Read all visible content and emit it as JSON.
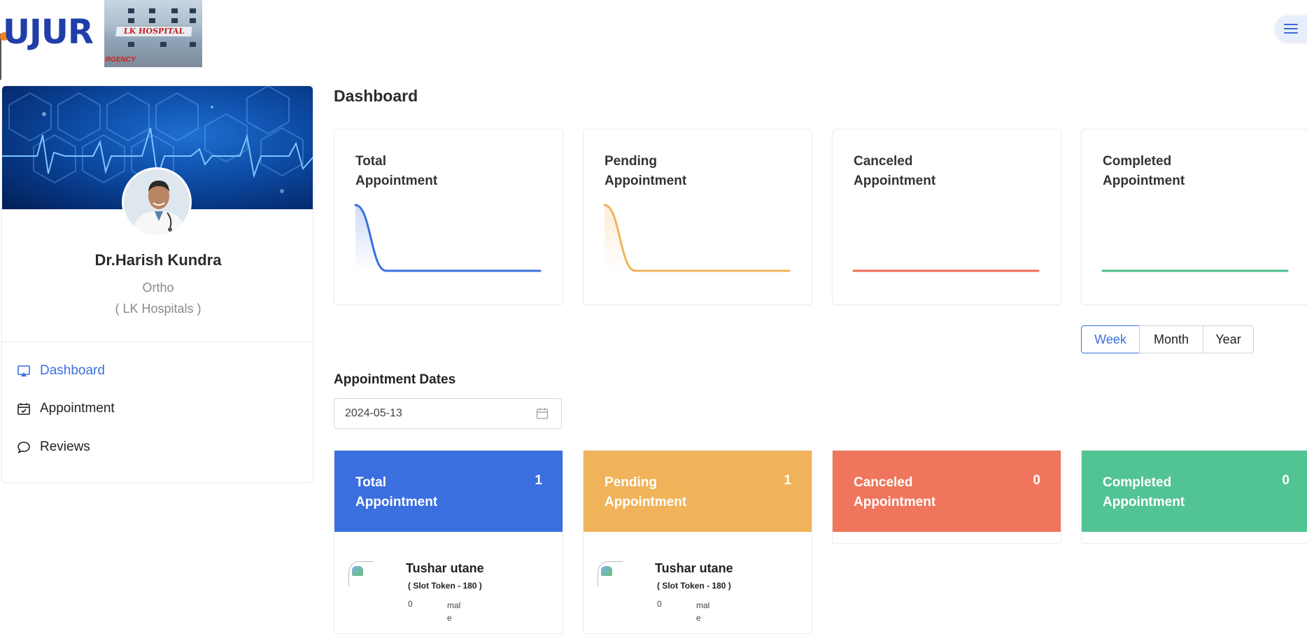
{
  "header": {
    "brand_text": "UJUR",
    "hospital_sign": "LK HOSPITAL",
    "hospital_sign_sub": "RGENCY",
    "menu_icon": "hamburger-menu-icon"
  },
  "sidebar": {
    "doctor_name": "Dr.Harish Kundra",
    "specialty": "Ortho",
    "hospital": "( LK Hospitals )",
    "items": [
      {
        "label": "Dashboard",
        "icon": "airplay-icon",
        "active": true
      },
      {
        "label": "Appointment",
        "icon": "calendar-check-icon",
        "active": false
      },
      {
        "label": "Reviews",
        "icon": "chat-bubble-icon",
        "active": false
      }
    ]
  },
  "main": {
    "title": "Dashboard",
    "stat_cards": [
      {
        "line1": "Total",
        "line2": "Appointment",
        "color": "#3b6fe0"
      },
      {
        "line1": "Pending",
        "line2": "Appointment",
        "color": "#f0b35a"
      },
      {
        "line1": "Canceled",
        "line2": "Appointment",
        "color": "#ee6e55"
      },
      {
        "line1": "Completed",
        "line2": "Appointment",
        "color": "#48c08e"
      }
    ],
    "period_buttons": [
      "Week",
      "Month",
      "Year"
    ],
    "selected_period": "Week",
    "dates_title": "Appointment Dates",
    "date_value": "2024-05-13",
    "count_cards": [
      {
        "line1": "Total",
        "line2": "Appointment",
        "count": "1",
        "color": "#3b6fe0"
      },
      {
        "line1": "Pending",
        "line2": "Appointment",
        "count": "1",
        "color": "#f0b35a"
      },
      {
        "line1": "Canceled",
        "line2": "Appointment",
        "count": "0",
        "color": "#ef755c"
      },
      {
        "line1": "Completed",
        "line2": "Appointment",
        "count": "0",
        "color": "#52c393"
      }
    ],
    "patients": [
      {
        "name": "Tushar utane",
        "token": "( Slot Token - 180 )",
        "age": "0",
        "gender": "male"
      },
      {
        "name": "Tushar utane",
        "token": "( Slot Token - 180 )",
        "age": "0",
        "gender": "male"
      }
    ]
  },
  "chart_data": [
    {
      "type": "area",
      "title": "Total Appointment",
      "x": [
        1,
        2,
        3,
        4,
        5,
        6,
        7
      ],
      "values": [
        1,
        0,
        0,
        0,
        0,
        0,
        0
      ],
      "color": "#3b6fe0"
    },
    {
      "type": "area",
      "title": "Pending Appointment",
      "x": [
        1,
        2,
        3,
        4,
        5,
        6,
        7
      ],
      "values": [
        1,
        0,
        0,
        0,
        0,
        0,
        0
      ],
      "color": "#f0b35a"
    },
    {
      "type": "area",
      "title": "Canceled Appointment",
      "x": [
        1,
        2,
        3,
        4,
        5,
        6,
        7
      ],
      "values": [
        0,
        0,
        0,
        0,
        0,
        0,
        0
      ],
      "color": "#ee6e55"
    },
    {
      "type": "area",
      "title": "Completed Appointment",
      "x": [
        1,
        2,
        3,
        4,
        5,
        6,
        7
      ],
      "values": [
        0,
        0,
        0,
        0,
        0,
        0,
        0
      ],
      "color": "#48c08e"
    }
  ]
}
